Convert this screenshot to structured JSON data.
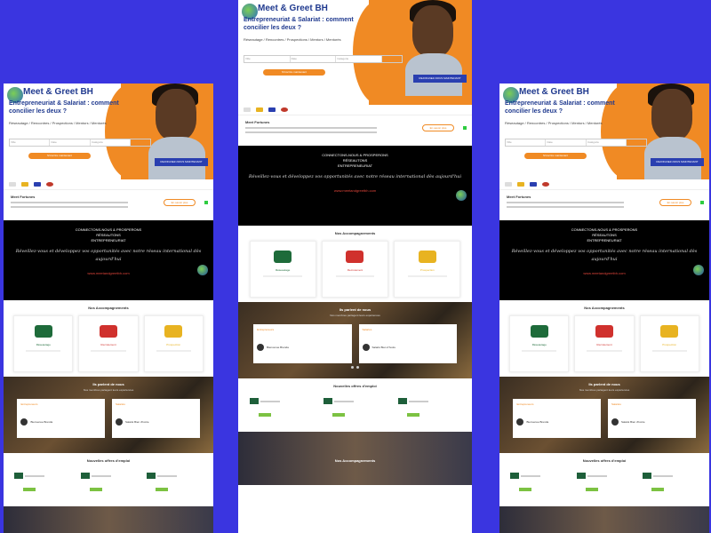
{
  "colors": {
    "background": "#3a35e0",
    "accent": "#f08a24",
    "brand": "#203a8f"
  },
  "hero": {
    "title": "Meet & Greet BH",
    "headline": "Entrepreneuriat & Salariat : comment concilier les deux ?",
    "subtitle": "Réseautage / Rencontres / Prospections / Mentors / Mentorés",
    "search_fields": [
      "Ville",
      "Date",
      "Catégorie"
    ],
    "cta": "S'inscrire maintenant",
    "badge": "REJOIGNEZ-NOUS MAINTENANT"
  },
  "about": {
    "title": "Meet Fortunes",
    "button": "En savoir plus"
  },
  "black_section": {
    "heading_lines": [
      "CONNECTONS-NOUS & PROSPERONS",
      "RÉSEAUTONS",
      "ENTREPRENEURIAT"
    ],
    "script_text": "Réveillez-vous et développez vos opportunités avec notre réseau international dès aujourd'hui",
    "link": "www.meetandgreetbh.com"
  },
  "accompaniment": {
    "title": "Nos Accompagnements",
    "cards": [
      {
        "label": "Réseautage",
        "color": "#1e6b3a",
        "icon": "people-icon"
      },
      {
        "label": "Recrutement",
        "color": "#d0312d",
        "icon": "person-icon"
      },
      {
        "label": "Prospection",
        "color": "#e8b321",
        "icon": "coins-icon"
      }
    ]
  },
  "photo_section": {
    "heading": "Ils parlent de nous",
    "subheading": "Nos membres partagent leurs expériences",
    "cards": [
      {
        "title": "Entrepreneurs",
        "author": "Bienvenue Brenda"
      },
      {
        "title": "Salariés",
        "author": "Salarié Bien d'Ivoire"
      }
    ]
  },
  "offers": {
    "title": "Nouvelles offres d'emploi",
    "items": [
      "Offre 1",
      "Offre 2",
      "Offre 3"
    ]
  },
  "footer_section": {
    "title": "Nos Accompagnements"
  }
}
